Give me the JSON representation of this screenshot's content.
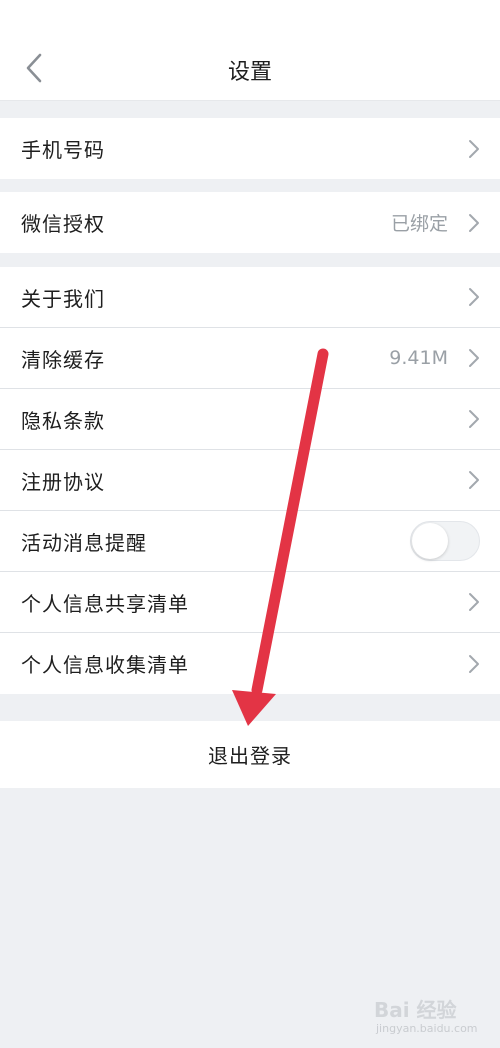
{
  "header": {
    "title": "设置",
    "back_icon": "chevron-left-icon"
  },
  "groups": [
    {
      "rows": [
        {
          "label": "手机号码",
          "value": "",
          "control": "chevron"
        }
      ]
    },
    {
      "rows": [
        {
          "label": "微信授权",
          "value": "已绑定",
          "control": "chevron"
        }
      ]
    },
    {
      "rows": [
        {
          "label": "关于我们",
          "value": "",
          "control": "chevron"
        },
        {
          "label": "清除缓存",
          "value": "9.41M",
          "control": "chevron"
        },
        {
          "label": "隐私条款",
          "value": "",
          "control": "chevron"
        },
        {
          "label": "注册协议",
          "value": "",
          "control": "chevron"
        },
        {
          "label": "活动消息提醒",
          "value": "",
          "control": "toggle",
          "toggle_on": false
        },
        {
          "label": "个人信息共享清单",
          "value": "",
          "control": "chevron"
        },
        {
          "label": "个人信息收集清单",
          "value": "",
          "control": "chevron"
        }
      ]
    }
  ],
  "logout": {
    "label": "退出登录"
  },
  "annotation": {
    "arrow_color": "#e33445"
  },
  "watermark": {
    "brand": "Bai 经验",
    "url": "jingyan.baidu.com"
  }
}
